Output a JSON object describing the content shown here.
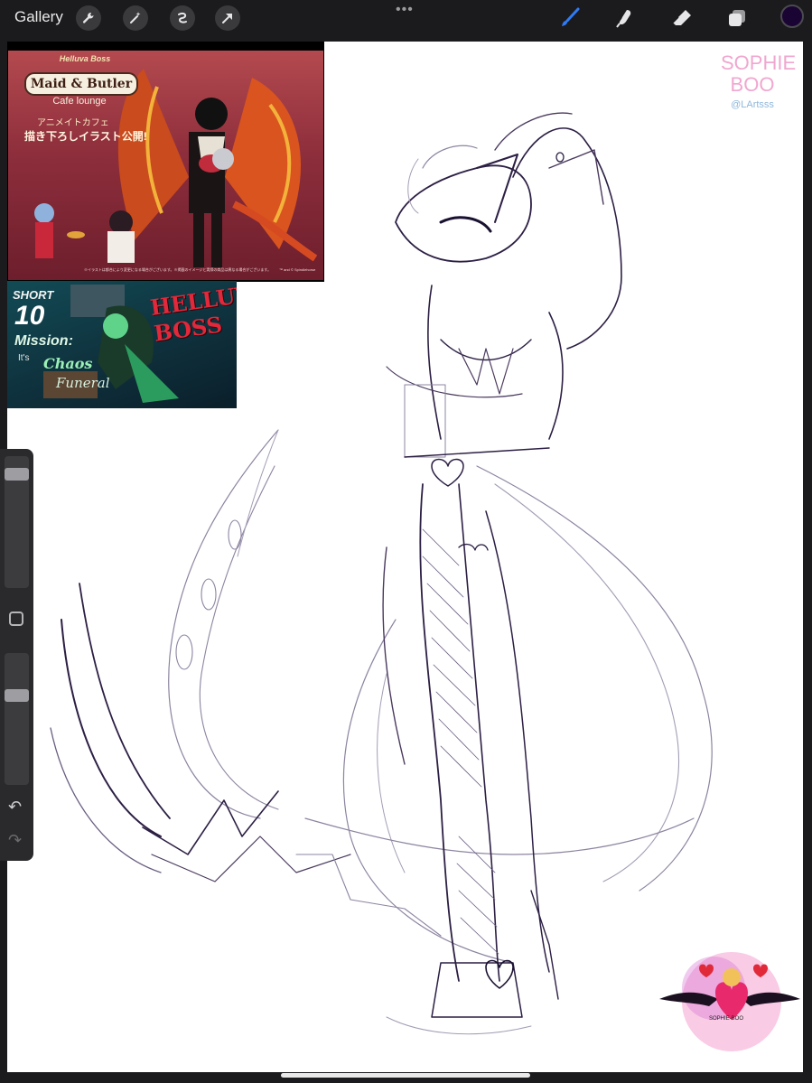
{
  "topbar": {
    "gallery_label": "Gallery",
    "more_dots": "•••",
    "tools_left": [
      "wrench-icon",
      "magic-wand-icon",
      "selection-icon",
      "transform-arrow-icon"
    ],
    "tools_right": [
      "brush-icon",
      "smudge-icon",
      "eraser-icon",
      "layers-icon"
    ],
    "active_tool": "brush",
    "current_color": "#1a0433",
    "brush_color": "#2f7bf6"
  },
  "references": {
    "cafe": {
      "series": "Helluva Boss",
      "title": "Maid & Butler",
      "subtitle": "Cafe lounge",
      "jp_line1": "アニメイトカフェ",
      "jp_line2": "描き下ろしイラスト公開!",
      "footnote": "※イラストは都合により変更になる場合がございます。※掲載のイメージと実際の商品は異なる場合がございます。",
      "trademark": "™ and © Spindlehorse"
    },
    "short": {
      "label": "SHORT",
      "number": "10",
      "line1": "Mission:",
      "line2": "It's",
      "line3": "Chaos",
      "line4": "Funeral",
      "logo": "HELLUVA BOSS"
    }
  },
  "signature": {
    "name_line1": "SOPHIE",
    "name_line2": "BOO",
    "handle": "@LArtsss"
  },
  "watermark": {
    "text": "SOPHIE-BOO"
  },
  "sidebar": {
    "brush_size_level": 0.1,
    "opacity_level": 0.3,
    "undo_icon": "↶",
    "redo_icon": "↷"
  }
}
